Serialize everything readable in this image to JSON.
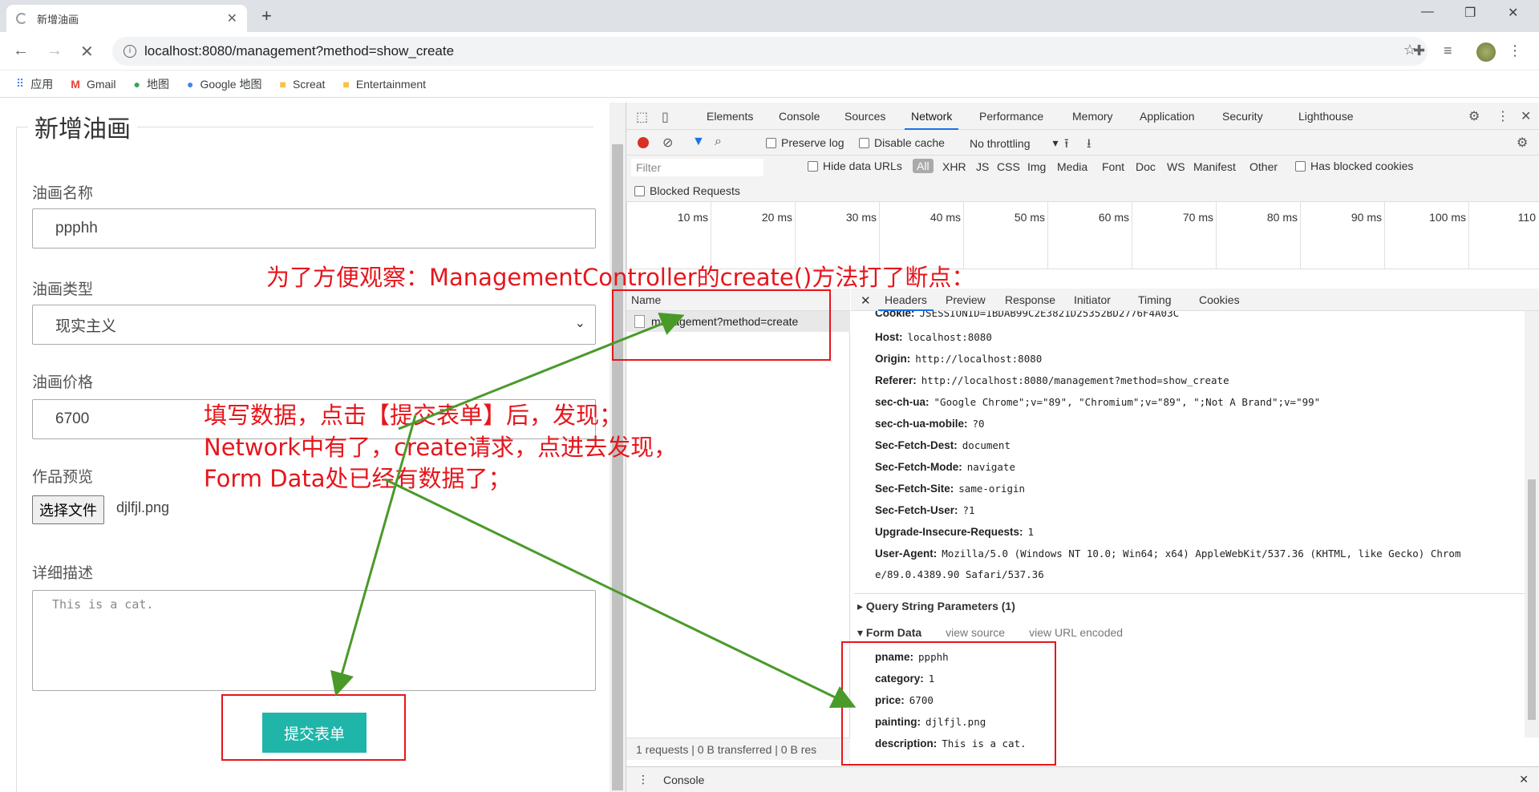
{
  "browser": {
    "tab_title": "新增油画",
    "url": "localhost:8080/management?method=show_create",
    "bookmarks": [
      "应用",
      "Gmail",
      "地图",
      "Google 地图",
      "Screat",
      "Entertainment"
    ]
  },
  "form": {
    "legend": "新增油画",
    "name_label": "油画名称",
    "name_value": "ppphh",
    "type_label": "油画类型",
    "type_value": "现实主义",
    "price_label": "油画价格",
    "price_value": "6700",
    "preview_label": "作品预览",
    "file_button": "选择文件",
    "file_name": "djlfjl.png",
    "desc_label": "详细描述",
    "desc_value": "This is a cat.",
    "submit_label": "提交表单"
  },
  "devtools": {
    "tabs": [
      "Elements",
      "Console",
      "Sources",
      "Network",
      "Performance",
      "Memory",
      "Application",
      "Security",
      "Lighthouse"
    ],
    "active_tab": "Network",
    "toolbar": {
      "preserve_log": "Preserve log",
      "disable_cache": "Disable cache",
      "throttling": "No throttling"
    },
    "filter_placeholder": "Filter",
    "hide_data_urls": "Hide data URLs",
    "types": [
      "All",
      "XHR",
      "JS",
      "CSS",
      "Img",
      "Media",
      "Font",
      "Doc",
      "WS",
      "Manifest",
      "Other"
    ],
    "has_blocked_cookies": "Has blocked cookies",
    "blocked_requests": "Blocked Requests",
    "ticks": [
      "10 ms",
      "20 ms",
      "30 ms",
      "40 ms",
      "50 ms",
      "60 ms",
      "70 ms",
      "80 ms",
      "90 ms",
      "100 ms",
      "110"
    ],
    "name_header": "Name",
    "request_name": "management?method=create",
    "detail_tabs": [
      "Headers",
      "Preview",
      "Response",
      "Initiator",
      "Timing",
      "Cookies"
    ],
    "headers": [
      {
        "k": "Cookie:",
        "v": "JSESSIONID=1BDAB99C2E3821D25352BD2776F4A03C"
      },
      {
        "k": "Host:",
        "v": "localhost:8080"
      },
      {
        "k": "Origin:",
        "v": "http://localhost:8080"
      },
      {
        "k": "Referer:",
        "v": "http://localhost:8080/management?method=show_create"
      },
      {
        "k": "sec-ch-ua:",
        "v": "\"Google Chrome\";v=\"89\", \"Chromium\";v=\"89\", \";Not A Brand\";v=\"99\""
      },
      {
        "k": "sec-ch-ua-mobile:",
        "v": "?0"
      },
      {
        "k": "Sec-Fetch-Dest:",
        "v": "document"
      },
      {
        "k": "Sec-Fetch-Mode:",
        "v": "navigate"
      },
      {
        "k": "Sec-Fetch-Site:",
        "v": "same-origin"
      },
      {
        "k": "Sec-Fetch-User:",
        "v": "?1"
      },
      {
        "k": "Upgrade-Insecure-Requests:",
        "v": "1"
      },
      {
        "k": "User-Agent:",
        "v": "Mozilla/5.0 (Windows NT 10.0; Win64; x64) AppleWebKit/537.36 (KHTML, like Gecko) Chrom"
      },
      {
        "k": "",
        "v": "e/89.0.4389.90 Safari/537.36"
      }
    ],
    "query_section": "Query String Parameters (1)",
    "form_section": "Form Data",
    "view_source": "view source",
    "view_url_encoded": "view URL encoded",
    "form_data": [
      {
        "k": "pname:",
        "v": "ppphh"
      },
      {
        "k": "category:",
        "v": "1"
      },
      {
        "k": "price:",
        "v": "6700"
      },
      {
        "k": "painting:",
        "v": "djlfjl.png"
      },
      {
        "k": "description:",
        "v": "This is a cat."
      }
    ],
    "status": "1 requests  |  0 B transferred  |  0 B res",
    "console_label": "Console"
  },
  "annotations": {
    "breakpoint_note": "为了方便观察：ManagementController的create()方法打了断点：",
    "line1": "填写数据，点击【提交表单】后，发现；",
    "line2": "Network中有了，create请求，点进去发现，",
    "line3": "Form Data处已经有数据了；",
    "color": "#e5161c",
    "arrow_color": "#4a9a2a"
  }
}
